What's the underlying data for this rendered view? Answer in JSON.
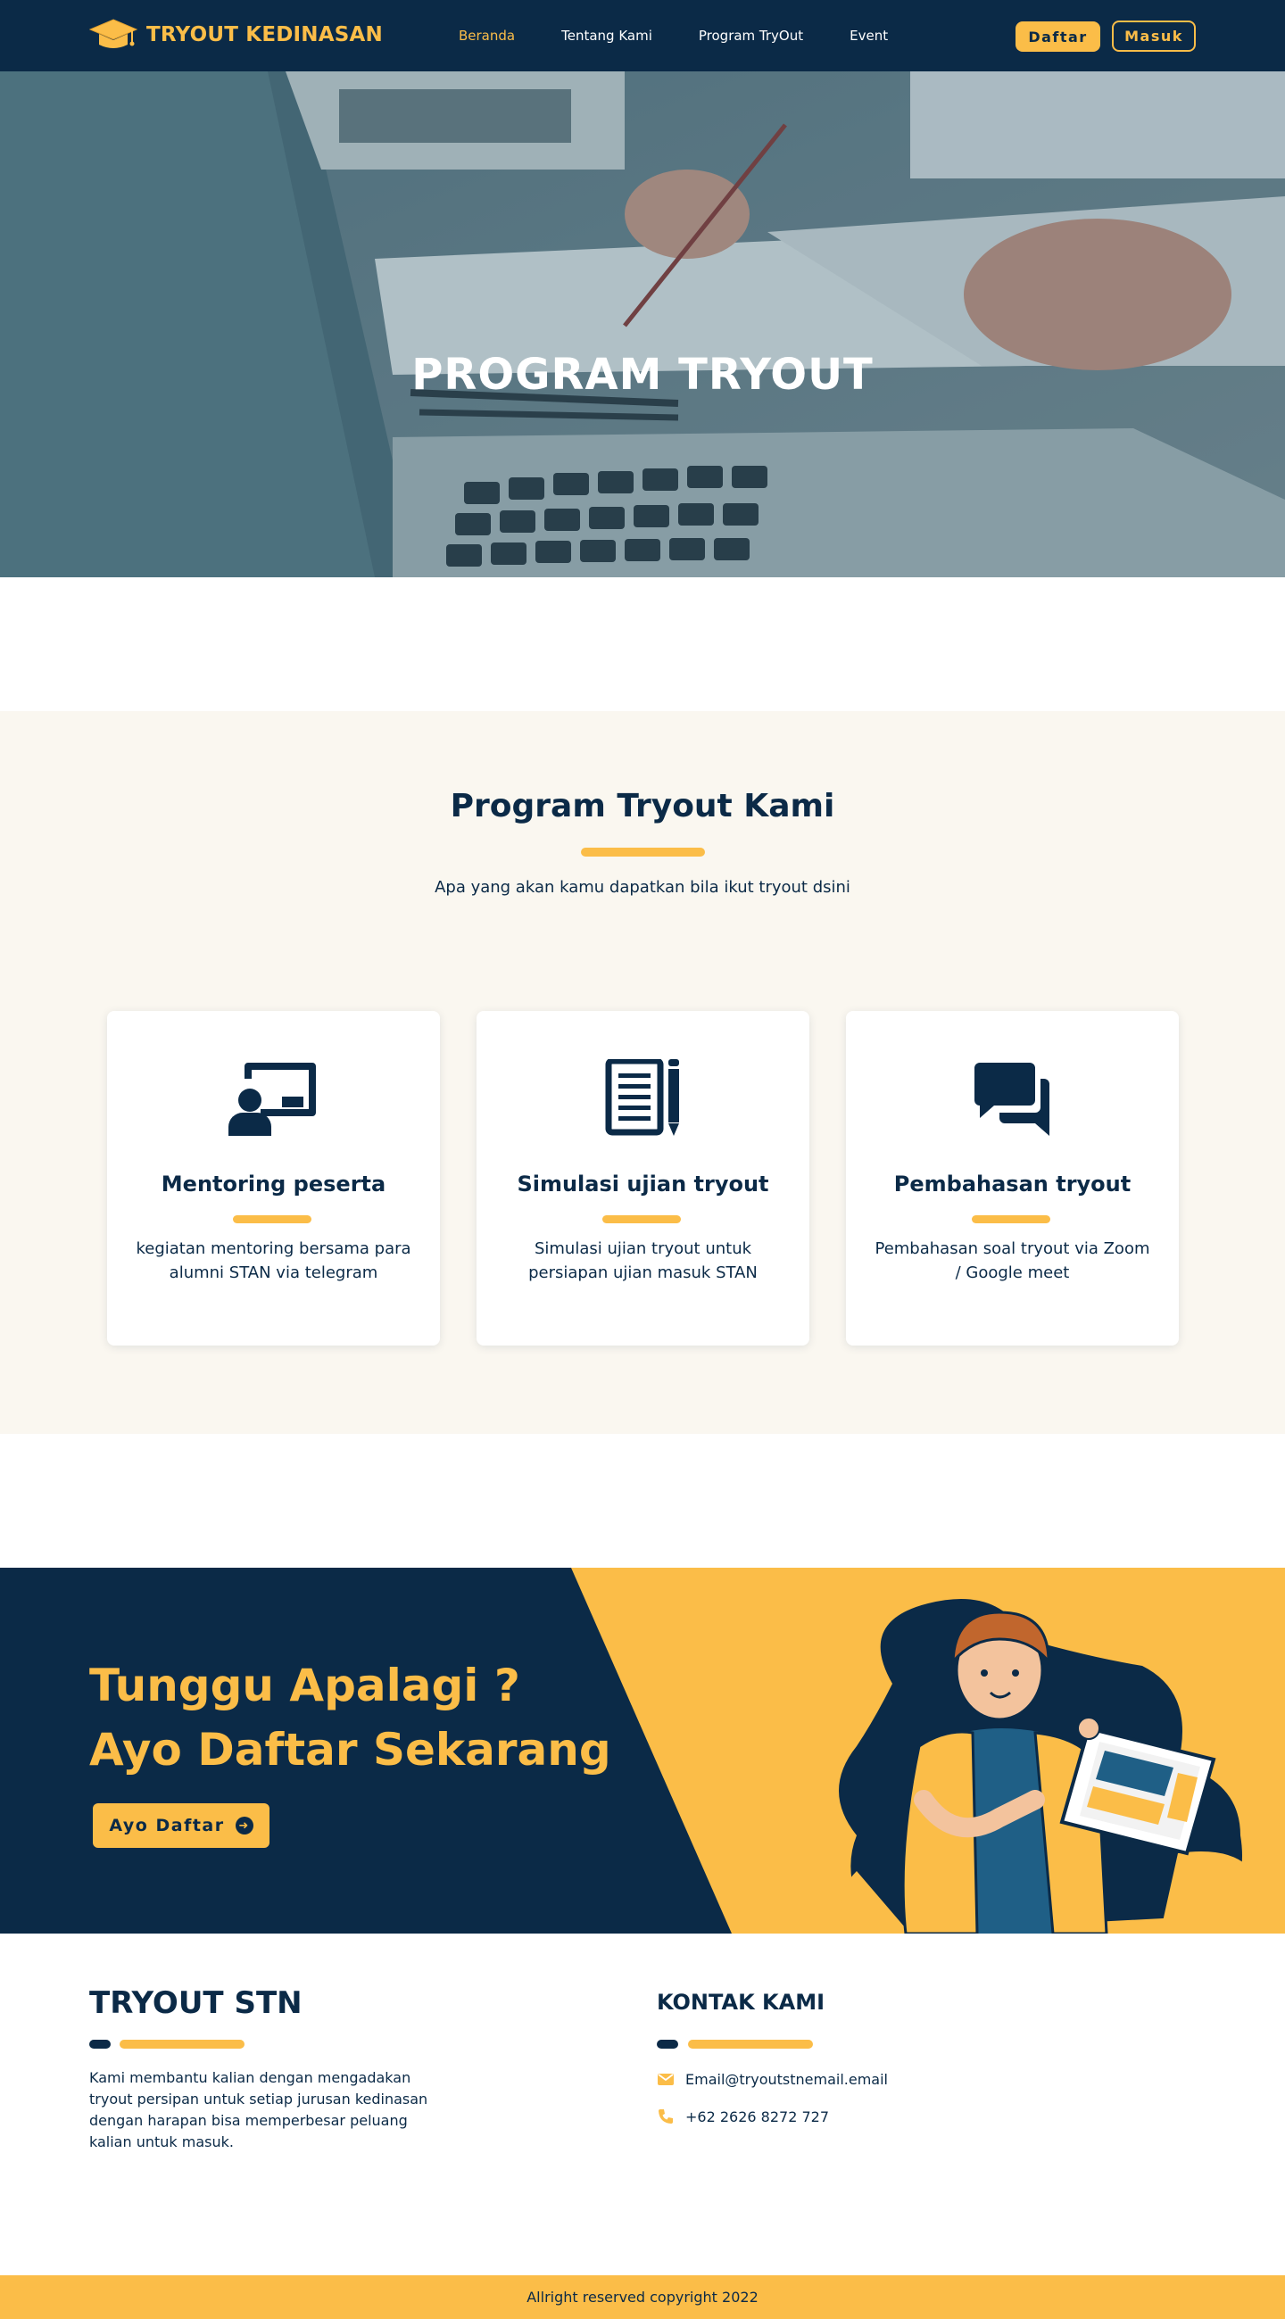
{
  "nav": {
    "brand": "TRYOUT KEDINASAN",
    "links": [
      "Beranda",
      "Tentang Kami",
      "Program TryOut",
      "Event"
    ],
    "active_link": "Beranda",
    "daftar": "Daftar",
    "masuk": "Masuk"
  },
  "hero": {
    "title": "PROGRAM TRYOUT"
  },
  "program": {
    "title": "Program Tryout Kami",
    "subtitle": "Apa  yang akan kamu dapatkan bila ikut tryout dsini",
    "cards": [
      {
        "icon": "mentoring-icon",
        "title": "Mentoring peserta",
        "text": "kegiatan mentoring bersama para alumni STAN via telegram"
      },
      {
        "icon": "exam-icon",
        "title": "Simulasi ujian tryout",
        "text": "Simulasi ujian tryout untuk persiapan ujian masuk STAN"
      },
      {
        "icon": "chat-icon",
        "title": "Pembahasan tryout",
        "text": "Pembahasan soal tryout via Zoom / Google meet"
      }
    ]
  },
  "cta": {
    "line1": "Tunggu Apalagi ?",
    "line2": "Ayo Daftar Sekarang",
    "button": "Ayo Daftar"
  },
  "footer": {
    "title": "TRYOUT STN",
    "description": "Kami membantu kalian dengan mengadakan tryout persipan untuk setiap jurusan kedinasan dengan harapan bisa memperbesar peluang kalian untuk masuk.",
    "contact_title": "KONTAK KAMI",
    "email": "Email@tryoutstnemail.email",
    "phone": "+62 2626 8272 727",
    "copyright": "Allright reserved copyright 2022"
  },
  "colors": {
    "navy": "#0b2a47",
    "yellow": "#fbbd48",
    "cream": "#faf7f0"
  }
}
